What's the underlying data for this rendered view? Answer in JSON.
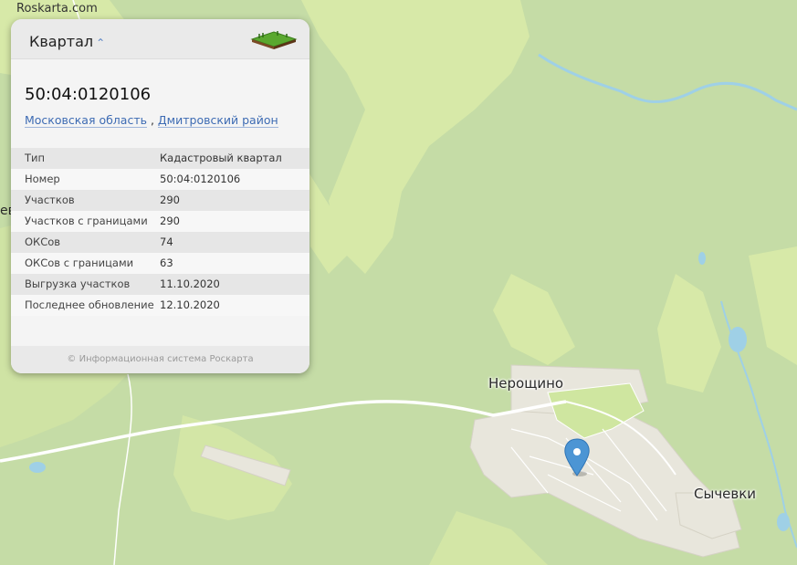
{
  "brand": "Roskarta.com",
  "edge_label": "ев",
  "places": [
    "Нерощино",
    "Сычевки"
  ],
  "card": {
    "title": "Квартал",
    "chevron_icon": "chevron-up-icon",
    "logo_icon": "land-plot-icon",
    "cad_number": "50:04:0120106",
    "region": "Московская область",
    "district": "Дмитровский район",
    "rows": [
      {
        "key": "Тип",
        "value": "Кадастровый квартал"
      },
      {
        "key": "Номер",
        "value": "50:04:0120106"
      },
      {
        "key": "Участков",
        "value": "290"
      },
      {
        "key": "Участков с границами",
        "value": "290"
      },
      {
        "key": "ОКСов",
        "value": "74"
      },
      {
        "key": "ОКСов с границами",
        "value": "63"
      },
      {
        "key": "Выгрузка участков",
        "value": "11.10.2020"
      },
      {
        "key": "Последнее обновление",
        "value": "12.10.2020"
      }
    ],
    "footer": "© Информационная система Роскарта"
  },
  "colors": {
    "forest": "#c5dca6",
    "field": "#d7e9a8",
    "settlement": "#e8e6dc",
    "water": "#9fd0e6",
    "marker": "#4c95d4"
  }
}
